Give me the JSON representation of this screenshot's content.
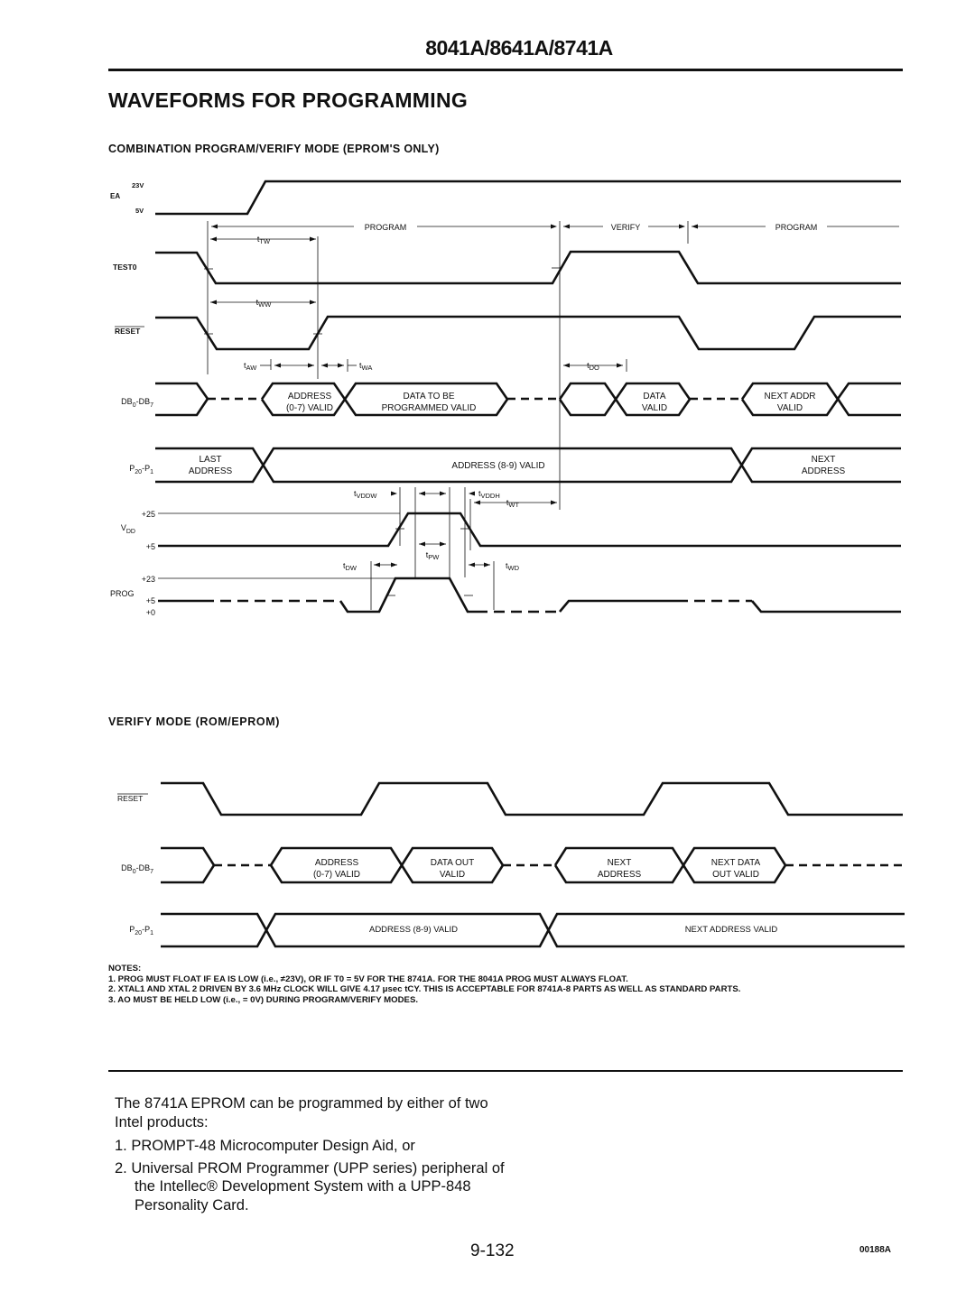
{
  "header": {
    "part_numbers": "8041A/8641A/8741A"
  },
  "section_title": "WAVEFORMS FOR PROGRAMMING",
  "diagram1": {
    "title": "COMBINATION PROGRAM/VERIFY MODE (EPROM'S ONLY)",
    "signals": {
      "ea": {
        "label": "EA",
        "levels": [
          "23V",
          "5V"
        ]
      },
      "test0": {
        "label": "TEST0"
      },
      "reset": {
        "label": "RESET",
        "overbar": true
      },
      "db": {
        "label": "DB0-DB7",
        "label_main": "DB",
        "sub0": "0",
        "mid": "-DB",
        "sub1": "7"
      },
      "p20": {
        "label": "P20-P1",
        "label_main": "P",
        "sub0": "20",
        "mid": "-P",
        "sub1": "1"
      },
      "vdd": {
        "label": "VDD",
        "label_main": "V",
        "sub0": "DD",
        "levels": [
          "+25",
          "+5"
        ]
      },
      "prog": {
        "label": "PROG",
        "levels": [
          "+23",
          "+5",
          "+0"
        ]
      }
    },
    "phases": [
      "PROGRAM",
      "VERIFY",
      "PROGRAM"
    ],
    "db_fields": [
      {
        "line1": "ADDRESS",
        "line2": "(0-7) VALID"
      },
      {
        "line1": "DATA TO BE",
        "line2": "PROGRAMMED VALID"
      },
      {
        "line1": "",
        "line2": ""
      },
      {
        "line1": "DATA",
        "line2": "VALID"
      },
      {
        "line1": "NEXT ADDR",
        "line2": "VALID"
      }
    ],
    "p20_fields": [
      {
        "line1": "LAST",
        "line2": "ADDRESS"
      },
      {
        "line1": "ADDRESS (8-9) VALID",
        "line2": ""
      },
      {
        "line1": "NEXT",
        "line2": "ADDRESS"
      }
    ],
    "timing_params": {
      "tTW": {
        "main": "t",
        "sub": "TW"
      },
      "tWW": {
        "main": "t",
        "sub": "WW"
      },
      "tAW": {
        "main": "t",
        "sub": "AW"
      },
      "tWA": {
        "main": "t",
        "sub": "WA"
      },
      "tDO": {
        "main": "t",
        "sub": "DO"
      },
      "tVDDW": {
        "main": "t",
        "sub": "VDDW"
      },
      "tVDDH": {
        "main": "t",
        "sub": "VDDH"
      },
      "tWT": {
        "main": "t",
        "sub": "WT"
      },
      "tPW": {
        "main": "t",
        "sub": "PW"
      },
      "tDW": {
        "main": "t",
        "sub": "DW"
      },
      "tWD": {
        "main": "t",
        "sub": "WD"
      }
    }
  },
  "diagram2": {
    "title": "VERIFY MODE (ROM/EPROM)",
    "signals": {
      "reset": {
        "label": "RESET",
        "overbar": true
      },
      "db": {
        "label": "DB0-DB7",
        "label_main": "DB",
        "sub0": "0",
        "mid": "-DB",
        "sub1": "7"
      },
      "p20": {
        "label": "P20-P1",
        "label_main": "P",
        "sub0": "20",
        "mid": "-P",
        "sub1": "1"
      }
    },
    "db_fields": [
      {
        "line1": "ADDRESS",
        "line2": "(0-7) VALID"
      },
      {
        "line1": "DATA OUT",
        "line2": "VALID"
      },
      {
        "line1": "NEXT",
        "line2": "ADDRESS"
      },
      {
        "line1": "NEXT DATA",
        "line2": "OUT VALID"
      }
    ],
    "p20_fields": [
      {
        "line1": "ADDRESS (8-9) VALID"
      },
      {
        "line1": "NEXT ADDRESS VALID"
      }
    ]
  },
  "notes": {
    "heading": "NOTES:",
    "items": [
      "1. PROG MUST FLOAT IF EA IS LOW (i.e., ≠23V), OR IF T0 = 5V FOR THE 8741A. FOR THE 8041A PROG MUST ALWAYS FLOAT.",
      "2. XTAL1 AND XTAL 2 DRIVEN BY 3.6 MHz CLOCK WILL GIVE 4.17 μsec tCY. THIS IS ACCEPTABLE FOR 8741A-8 PARTS AS WELL AS STANDARD PARTS.",
      "3. AO MUST BE HELD LOW (i.e., = 0V) DURING PROGRAM/VERIFY MODES."
    ]
  },
  "body": {
    "intro": "The 8741A EPROM can be programmed by either of two Intel products:",
    "items": [
      "1. PROMPT-48 Microcomputer Design Aid, or",
      "2. Universal PROM Programmer (UPP series) peripheral of the Intellec® Development System with a UPP-848 Personality Card."
    ]
  },
  "footer": {
    "page_number": "9-132",
    "doc_id": "00188A"
  }
}
